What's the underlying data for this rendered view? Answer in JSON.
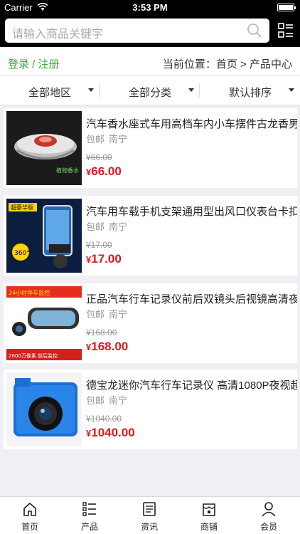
{
  "status_bar": {
    "carrier": "Carrier",
    "time": "3:53 PM"
  },
  "search": {
    "placeholder": "请输入商品关键字"
  },
  "crumb": {
    "login": "登录 / 注册",
    "position": "当前位置：首页 > 产品中心"
  },
  "filters": [
    {
      "label": "全部地区"
    },
    {
      "label": "全部分类"
    },
    {
      "label": "默认排序"
    }
  ],
  "products": [
    {
      "title": "汽车香水座式车用高档车内小车摆件古龙香男",
      "shipping": "包邮",
      "location": "南宁",
      "old_price": "¥66.00",
      "price": "66.00",
      "thumb_text": "植物香水"
    },
    {
      "title": "汽车用车载手机支架通用型出风口仪表台卡扣",
      "shipping": "包邮",
      "location": "南宁",
      "old_price": "¥17.00",
      "price": "17.00",
      "thumb_text": "超豪华版"
    },
    {
      "title": "正品汽车行车记录仪前后双镜头后视镜高清夜",
      "shipping": "包邮",
      "location": "南宁",
      "old_price": "¥168.00",
      "price": "168.00",
      "thumb_text": "24小时停车监控",
      "thumb_text2": "2600万像素 前后监控"
    },
    {
      "title": "德宝龙迷你汽车行车记录仪 高清1080P夜视超",
      "shipping": "包邮",
      "location": "南宁",
      "old_price": "¥1040.00",
      "price": "1040.00"
    }
  ],
  "currency_symbol": "¥",
  "tabs": [
    {
      "label": "首页",
      "icon": "home-icon"
    },
    {
      "label": "产品",
      "icon": "list-icon"
    },
    {
      "label": "资讯",
      "icon": "news-icon"
    },
    {
      "label": "商铺",
      "icon": "shop-icon"
    },
    {
      "label": "会员",
      "icon": "user-icon"
    }
  ],
  "colors": {
    "accent_green": "#3aaa35",
    "price_red": "#e4161c",
    "header_bg": "#000000"
  }
}
